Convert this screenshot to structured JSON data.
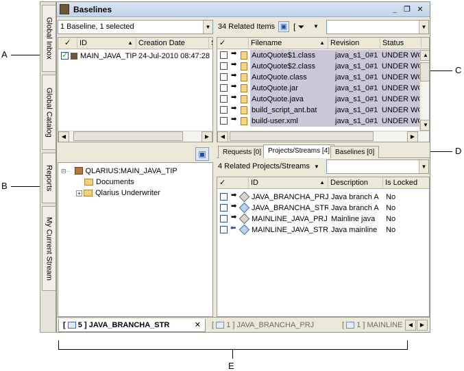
{
  "callouts": {
    "a": "A",
    "b": "B",
    "c": "C",
    "d": "D",
    "e": "E"
  },
  "vertical_tabs": [
    {
      "label": "Global Inbox"
    },
    {
      "label": "Global Catalog"
    },
    {
      "label": "Reports"
    },
    {
      "label": "My Current Stream"
    }
  ],
  "window": {
    "title": "Baselines",
    "minimize": "_",
    "restore": "❐",
    "close": "✕"
  },
  "baselines_panel": {
    "summary": "1 Baseline, 1 selected",
    "columns": [
      "ID",
      "Creation Date",
      "S"
    ],
    "rows": [
      {
        "id": "MAIN_JAVA_TIP",
        "creation_date": "24-Jul-2010 08:47:28",
        "checked": true
      }
    ]
  },
  "tree": {
    "root": "QLARIUS:MAIN_JAVA_TIP",
    "children": [
      "Documents",
      "Qlarius Underwriter"
    ]
  },
  "related_items": {
    "summary": "34 Related Items",
    "columns": [
      "Filename",
      "Revision",
      "Status"
    ],
    "rows": [
      {
        "filename": "AutoQuote$1.class",
        "revision": "java_s1_0#1",
        "status": "UNDER WO"
      },
      {
        "filename": "AutoQuote$2.class",
        "revision": "java_s1_0#1",
        "status": "UNDER WO"
      },
      {
        "filename": "AutoQuote.class",
        "revision": "java_s1_0#1",
        "status": "UNDER WO"
      },
      {
        "filename": "AutoQuote.jar",
        "revision": "java_s1_0#1",
        "status": "UNDER WO"
      },
      {
        "filename": "AutoQuote.java",
        "revision": "java_s1_0#1",
        "status": "UNDER WO"
      },
      {
        "filename": "build_script_ant.bat",
        "revision": "java_s1_0#1",
        "status": "UNDER WO"
      },
      {
        "filename": "build-user.xml",
        "revision": "java_s1_0#1",
        "status": "UNDER WO"
      }
    ]
  },
  "lower_tabs": [
    {
      "label": "Requests [0]"
    },
    {
      "label": "Projects/Streams [4]"
    },
    {
      "label": "Baselines [0]"
    }
  ],
  "projects_streams": {
    "summary": "4 Related Projects/Streams",
    "columns": [
      "ID",
      "Description",
      "Is Locked"
    ],
    "rows": [
      {
        "id": "JAVA_BRANCHA_PRJ",
        "description": "Java branch A",
        "locked": "No",
        "kind": "P"
      },
      {
        "id": "JAVA_BRANCHA_STR",
        "description": "Java branch A",
        "locked": "No",
        "kind": "S"
      },
      {
        "id": "MAINLINE_JAVA_PRJ",
        "description": "Mainline java",
        "locked": "No",
        "kind": "P"
      },
      {
        "id": "MAINLINE_JAVA_STR",
        "description": "Java mainline",
        "locked": "No",
        "kind": "S"
      }
    ]
  },
  "bottom_tabs": [
    {
      "count": "5",
      "label": "JAVA_BRANCHA_STR"
    },
    {
      "count": "1",
      "label": "JAVA_BRANCHA_PRJ"
    },
    {
      "count": "1",
      "label": "MAINLINE"
    }
  ]
}
